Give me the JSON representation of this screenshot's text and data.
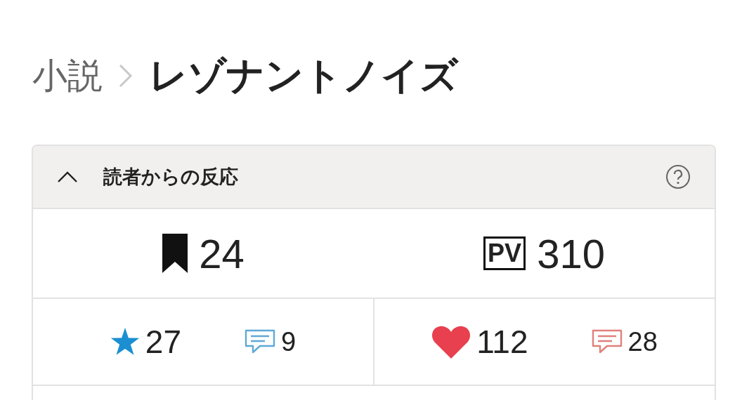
{
  "breadcrumb": {
    "parent": "小説",
    "title": "レゾナントノイズ"
  },
  "panel": {
    "title": "読者からの反応",
    "expanded": true,
    "totals": [
      {
        "kind": "bookmark",
        "value": "24"
      },
      {
        "kind": "pv",
        "label": "PV",
        "value": "310"
      }
    ],
    "reactions": [
      {
        "kind": "star",
        "count": "27",
        "comments": "9"
      },
      {
        "kind": "heart",
        "count": "112",
        "comments": "28"
      }
    ]
  }
}
